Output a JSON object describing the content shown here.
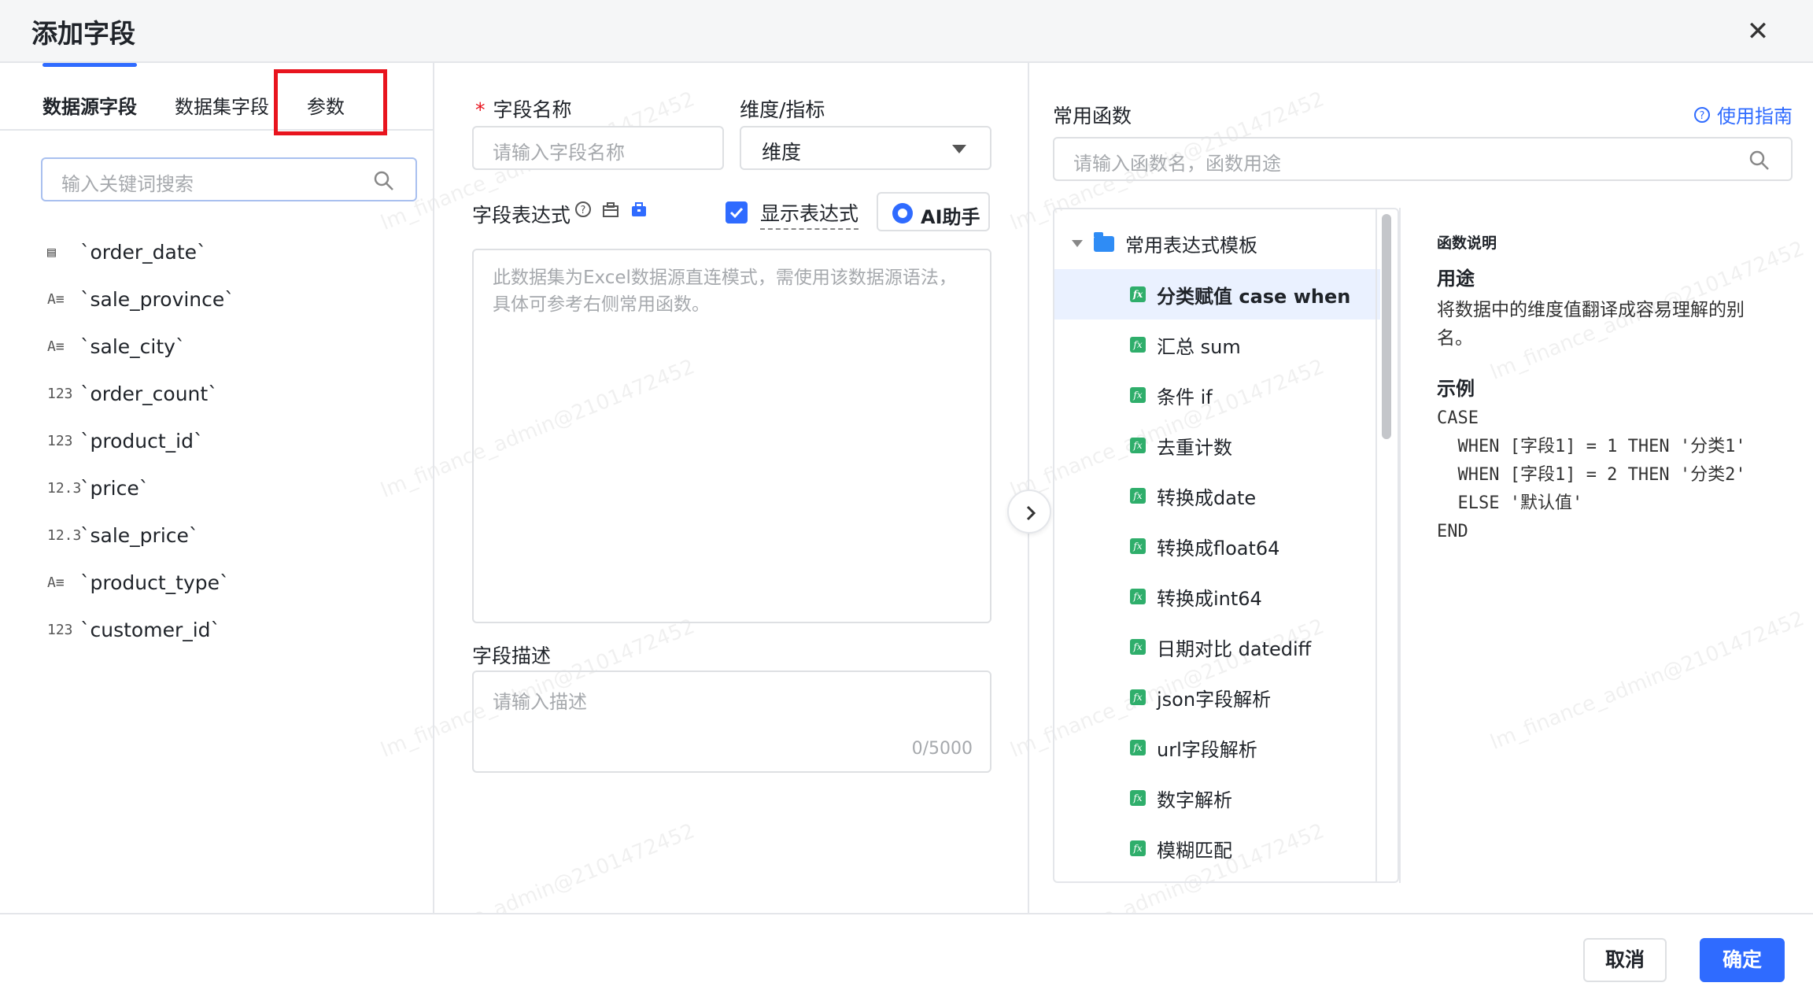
{
  "dialog": {
    "title": "添加字段"
  },
  "tabs": [
    {
      "label": "数据源字段"
    },
    {
      "label": "数据集字段"
    },
    {
      "label": "参数"
    }
  ],
  "field_search": {
    "placeholder": "输入关键词搜索"
  },
  "fields": [
    {
      "type_icon": "date-icon",
      "icon_text": "▤",
      "name": "`order_date`"
    },
    {
      "type_icon": "text-icon",
      "icon_text": "A≡",
      "name": "`sale_province`"
    },
    {
      "type_icon": "text-icon",
      "icon_text": "A≡",
      "name": "`sale_city`"
    },
    {
      "type_icon": "integer-icon",
      "icon_text": "123",
      "name": "`order_count`"
    },
    {
      "type_icon": "integer-icon",
      "icon_text": "123",
      "name": "`product_id`"
    },
    {
      "type_icon": "decimal-icon",
      "icon_text": "12.3",
      "name": "`price`"
    },
    {
      "type_icon": "decimal-icon",
      "icon_text": "12.3",
      "name": "`sale_price`"
    },
    {
      "type_icon": "text-icon",
      "icon_text": "A≡",
      "name": "`product_type`"
    },
    {
      "type_icon": "integer-icon",
      "icon_text": "123",
      "name": "`customer_id`"
    }
  ],
  "form": {
    "required_mark": "*",
    "name_label": "字段名称",
    "name_placeholder": "请输入字段名称",
    "dim_label": "维度/指标",
    "dim_value": "维度",
    "expr_label": "字段表达式",
    "show_expr_label": "显示表达式",
    "ai_label": "AI助手",
    "expr_placeholder": "此数据集为Excel数据源直连模式，需使用该数据源语法，具体可参考右侧常用函数。",
    "desc_label": "字段描述",
    "desc_placeholder": "请输入描述",
    "desc_count": "0/5000"
  },
  "functions": {
    "title": "常用函数",
    "guide_label": "使用指南",
    "search_placeholder": "请输入函数名，函数用途",
    "group": "常用表达式模板",
    "items": [
      {
        "label": "分类赋值 case when",
        "selected": true
      },
      {
        "label": "汇总 sum"
      },
      {
        "label": "条件 if"
      },
      {
        "label": "去重计数"
      },
      {
        "label": "转换成date"
      },
      {
        "label": "转换成float64"
      },
      {
        "label": "转换成int64"
      },
      {
        "label": "日期对比 datediff"
      },
      {
        "label": "json字段解析"
      },
      {
        "label": "url字段解析"
      },
      {
        "label": "数字解析"
      },
      {
        "label": "模糊匹配"
      }
    ]
  },
  "doc": {
    "heading": "函数说明",
    "usage_title": "用途",
    "usage_text": "将数据中的维度值翻译成容易理解的别名。",
    "example_title": "示例",
    "example_code": "CASE\n  WHEN [字段1] = 1 THEN '分类1'\n  WHEN [字段1] = 2 THEN '分类2'\n  ELSE '默认值'\nEND"
  },
  "footer": {
    "cancel": "取消",
    "ok": "确定"
  },
  "watermark": "lm_finance_admin@2101472452",
  "colors": {
    "accent": "#2f6bff",
    "highlight": "#e8141e",
    "fx": "#2fae6b"
  }
}
